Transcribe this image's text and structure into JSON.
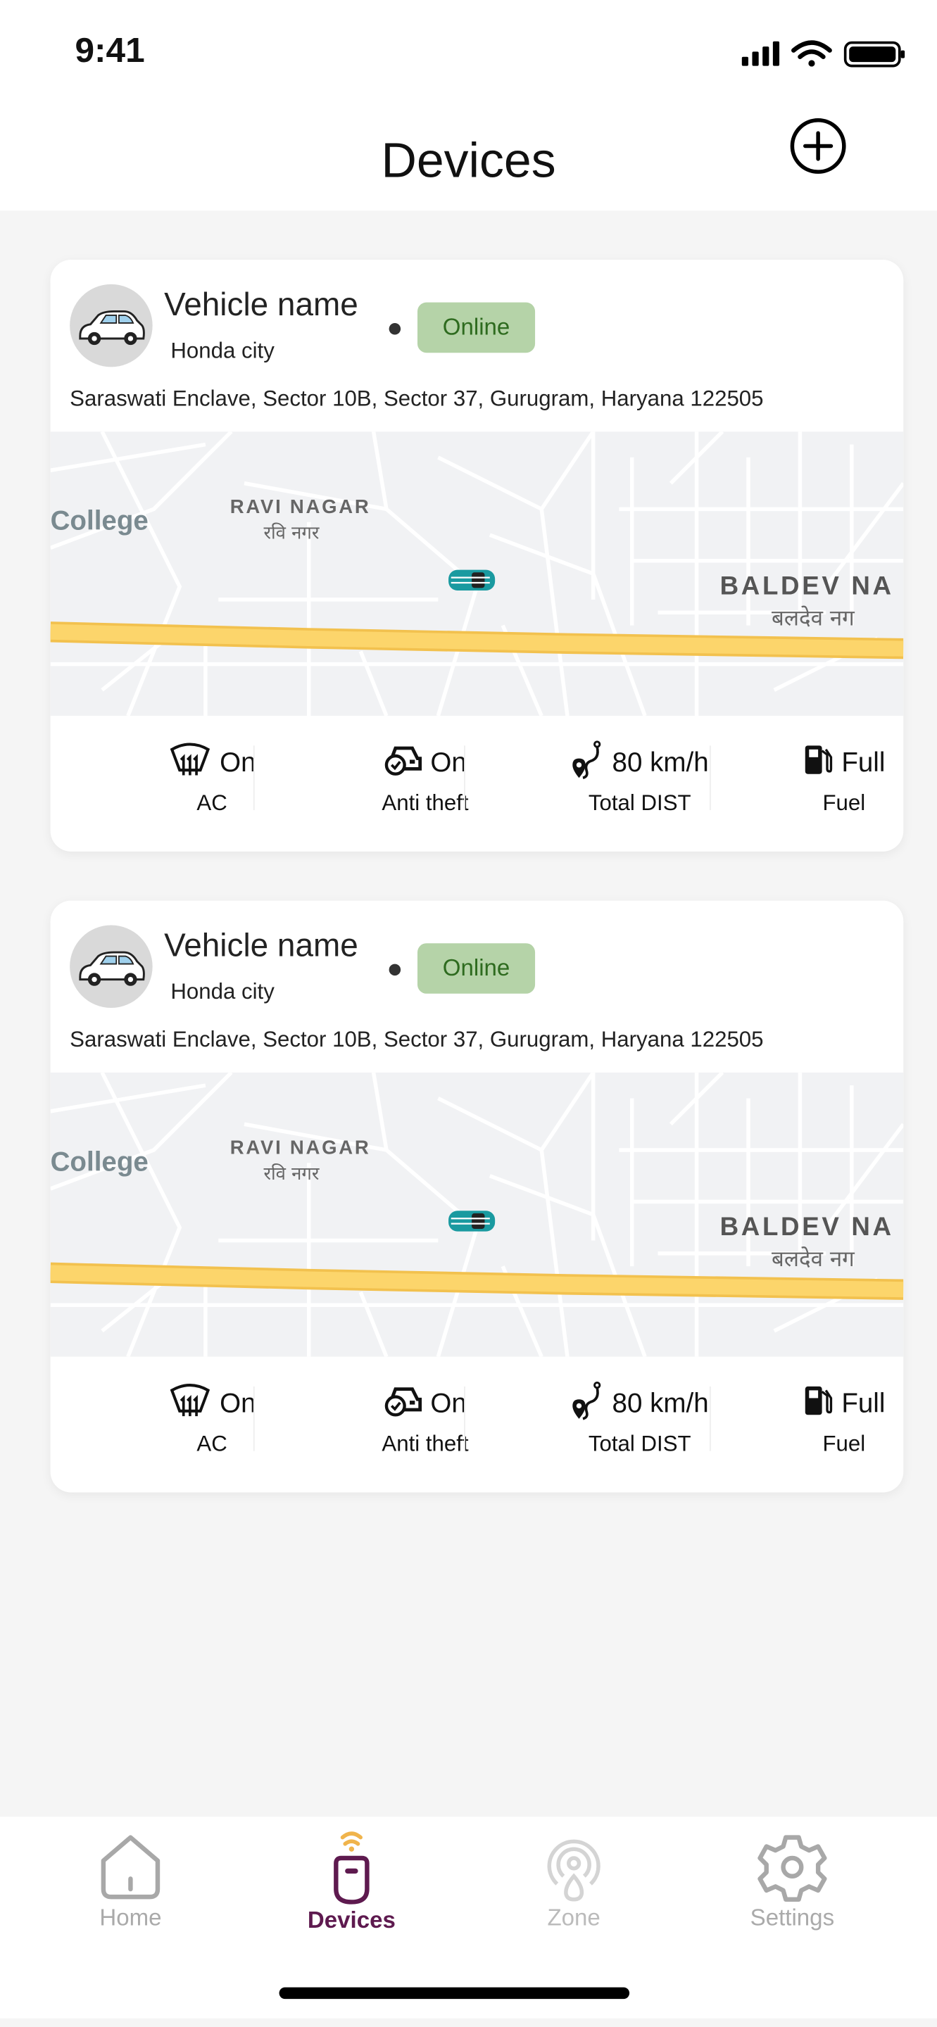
{
  "status_bar": {
    "time": "9:41",
    "icons": [
      "signal-icon",
      "wifi-icon",
      "battery-icon"
    ]
  },
  "header": {
    "title": "Devices",
    "add_icon": "plus-circle-icon"
  },
  "colors": {
    "online_bg": "#b5d3a8",
    "online_text": "#2e6b1f",
    "active_tab": "#5e1a4f",
    "signal_accent": "#f0b44c",
    "inactive": "#a8a8a8",
    "highway": "#fcd56b",
    "car_marker": "#1a9aa0"
  },
  "cards": [
    {
      "name": "Vehicle name",
      "model": "Honda city",
      "status": "Online",
      "address": "Saraswati Enclave, Sector 10B, Sector 37, Gurugram, Haryana 122505",
      "map": {
        "labels": [
          "College",
          "RAVI NAGAR",
          "रवि नगर",
          "BALDEV NA",
          "बलदेव नग"
        ]
      },
      "stats": [
        {
          "icon": "ac-defrost-icon",
          "value": "On",
          "label": "AC"
        },
        {
          "icon": "car-check-icon",
          "value": "On",
          "label": "Anti theft"
        },
        {
          "icon": "route-pin-icon",
          "value": "80 km/h",
          "label": "Total DIST"
        },
        {
          "icon": "fuel-pump-icon",
          "value": "Full",
          "label": "Fuel"
        }
      ]
    },
    {
      "name": "Vehicle name",
      "model": "Honda city",
      "status": "Online",
      "address": "Saraswati Enclave, Sector 10B, Sector 37, Gurugram, Haryana 122505",
      "map": {
        "labels": [
          "College",
          "RAVI NAGAR",
          "रवि नगर",
          "BALDEV NA",
          "बलदेव नग"
        ]
      },
      "stats": [
        {
          "icon": "ac-defrost-icon",
          "value": "On",
          "label": "AC"
        },
        {
          "icon": "car-check-icon",
          "value": "On",
          "label": "Anti theft"
        },
        {
          "icon": "route-pin-icon",
          "value": "80 km/h",
          "label": "Total DIST"
        },
        {
          "icon": "fuel-pump-icon",
          "value": "Full",
          "label": "Fuel"
        }
      ]
    }
  ],
  "nav": {
    "active": "Devices",
    "items": [
      {
        "label": "Home",
        "icon": "home-icon"
      },
      {
        "label": "Devices",
        "icon": "device-icon"
      },
      {
        "label": "Zone",
        "icon": "zone-icon"
      },
      {
        "label": "Settings",
        "icon": "gear-icon"
      }
    ]
  }
}
